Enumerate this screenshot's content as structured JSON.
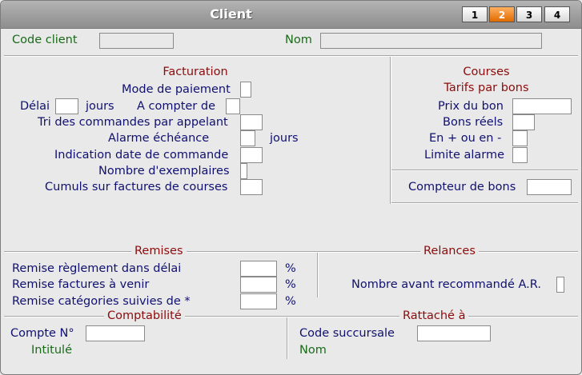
{
  "window": {
    "title": "Client"
  },
  "tabs": [
    "1",
    "2",
    "3",
    "4"
  ],
  "header": {
    "code_client_label": "Code client",
    "nom_label": "Nom"
  },
  "facturation": {
    "title": "Facturation",
    "mode_paiement": "Mode de paiement",
    "delai": "Délai",
    "jours": "jours",
    "a_compter_de": "A compter de",
    "tri_commandes": "Tri des commandes par appelant",
    "alarme_echeance": "Alarme échéance",
    "alarme_jours": "jours",
    "indication_date": "Indication date de commande",
    "nombre_exemplaires": "Nombre d'exemplaires",
    "cumuls": "Cumuls sur factures de courses"
  },
  "courses": {
    "title": "Courses",
    "subtitle": "Tarifs par bons",
    "prix_du_bon": "Prix du bon",
    "bons_reels": "Bons réels",
    "en_plus_ou_moins": "En + ou en -",
    "limite_alarme": "Limite alarme",
    "compteur_de_bons": "Compteur de bons"
  },
  "remises": {
    "title": "Remises",
    "reglement": "Remise règlement dans délai",
    "factures_venir": "Remise factures à venir",
    "categories": "Remise catégories suivies de *",
    "percent": "%"
  },
  "relances": {
    "title": "Relances",
    "nombre_avant": "Nombre avant recommandé A.R."
  },
  "comptabilite": {
    "title": "Comptabilité",
    "compte_no": "Compte N°",
    "intitule": "Intitulé"
  },
  "rattache": {
    "title": "Rattaché à",
    "code_succursale": "Code succursale",
    "nom": "Nom"
  }
}
